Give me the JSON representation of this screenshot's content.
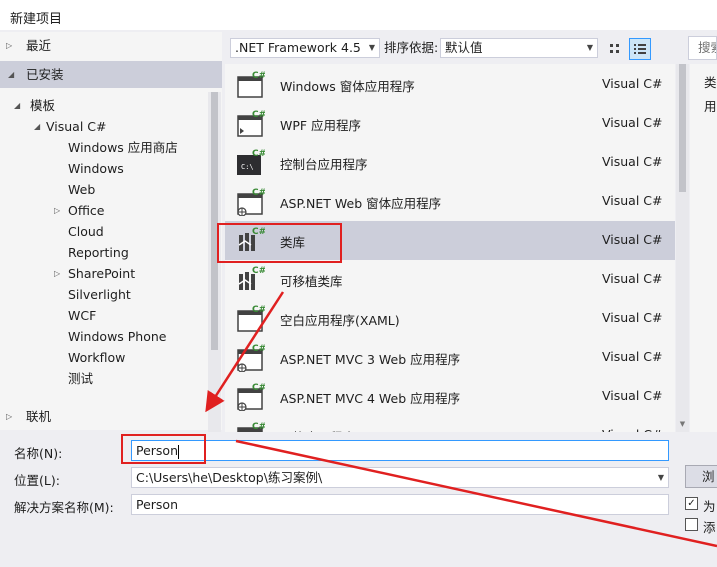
{
  "window": {
    "title": "新建项目"
  },
  "tree": {
    "recent": "最近",
    "installed": "已安装",
    "templates": "模板",
    "visual_csharp": "Visual C#",
    "children": [
      "Windows 应用商店",
      "Windows",
      "Web",
      "Office",
      "Cloud",
      "Reporting",
      "SharePoint",
      "Silverlight",
      "WCF",
      "Windows Phone",
      "Workflow",
      "测试"
    ],
    "online": "联机"
  },
  "toolbar": {
    "framework": ".NET Framework 4.5",
    "sort_label": "排序依据:",
    "sort_value": "默认值",
    "search_placeholder": "搜索"
  },
  "templates": [
    {
      "name": "Windows 窗体应用程序",
      "lang": "Visual C#",
      "icon": "windows-forms-icon"
    },
    {
      "name": "WPF 应用程序",
      "lang": "Visual C#",
      "icon": "wpf-icon"
    },
    {
      "name": "控制台应用程序",
      "lang": "Visual C#",
      "icon": "console-icon"
    },
    {
      "name": "ASP.NET Web 窗体应用程序",
      "lang": "Visual C#",
      "icon": "web-forms-icon"
    },
    {
      "name": "类库",
      "lang": "Visual C#",
      "icon": "class-library-icon"
    },
    {
      "name": "可移植类库",
      "lang": "Visual C#",
      "icon": "portable-library-icon"
    },
    {
      "name": "空白应用程序(XAML)",
      "lang": "Visual C#",
      "icon": "blank-app-icon"
    },
    {
      "name": "ASP.NET MVC 3 Web 应用程序",
      "lang": "Visual C#",
      "icon": "mvc3-icon"
    },
    {
      "name": "ASP.NET MVC 4 Web 应用程序",
      "lang": "Visual C#",
      "icon": "mvc4-icon"
    },
    {
      "name": "网格应用程序(XAML)",
      "lang": "Visual C#",
      "icon": "grid-app-icon"
    }
  ],
  "selected_template_index": 4,
  "description": {
    "type_label": "类",
    "desc_start": "用"
  },
  "form": {
    "name_label": "名称(N):",
    "name_value": "Person",
    "location_label": "位置(L):",
    "location_value": "C:\\Users\\he\\Desktop\\练习案例\\",
    "solution_label": "解决方案名称(M):",
    "solution_value": "Person",
    "browse_label": "浏览",
    "create_dir_label": "为",
    "create_dir_checked": true,
    "add_source_label": "添",
    "add_source_checked": false
  },
  "colors": {
    "annotation": "#e02020",
    "selection": "#ccceda",
    "focus": "#3399ff"
  }
}
